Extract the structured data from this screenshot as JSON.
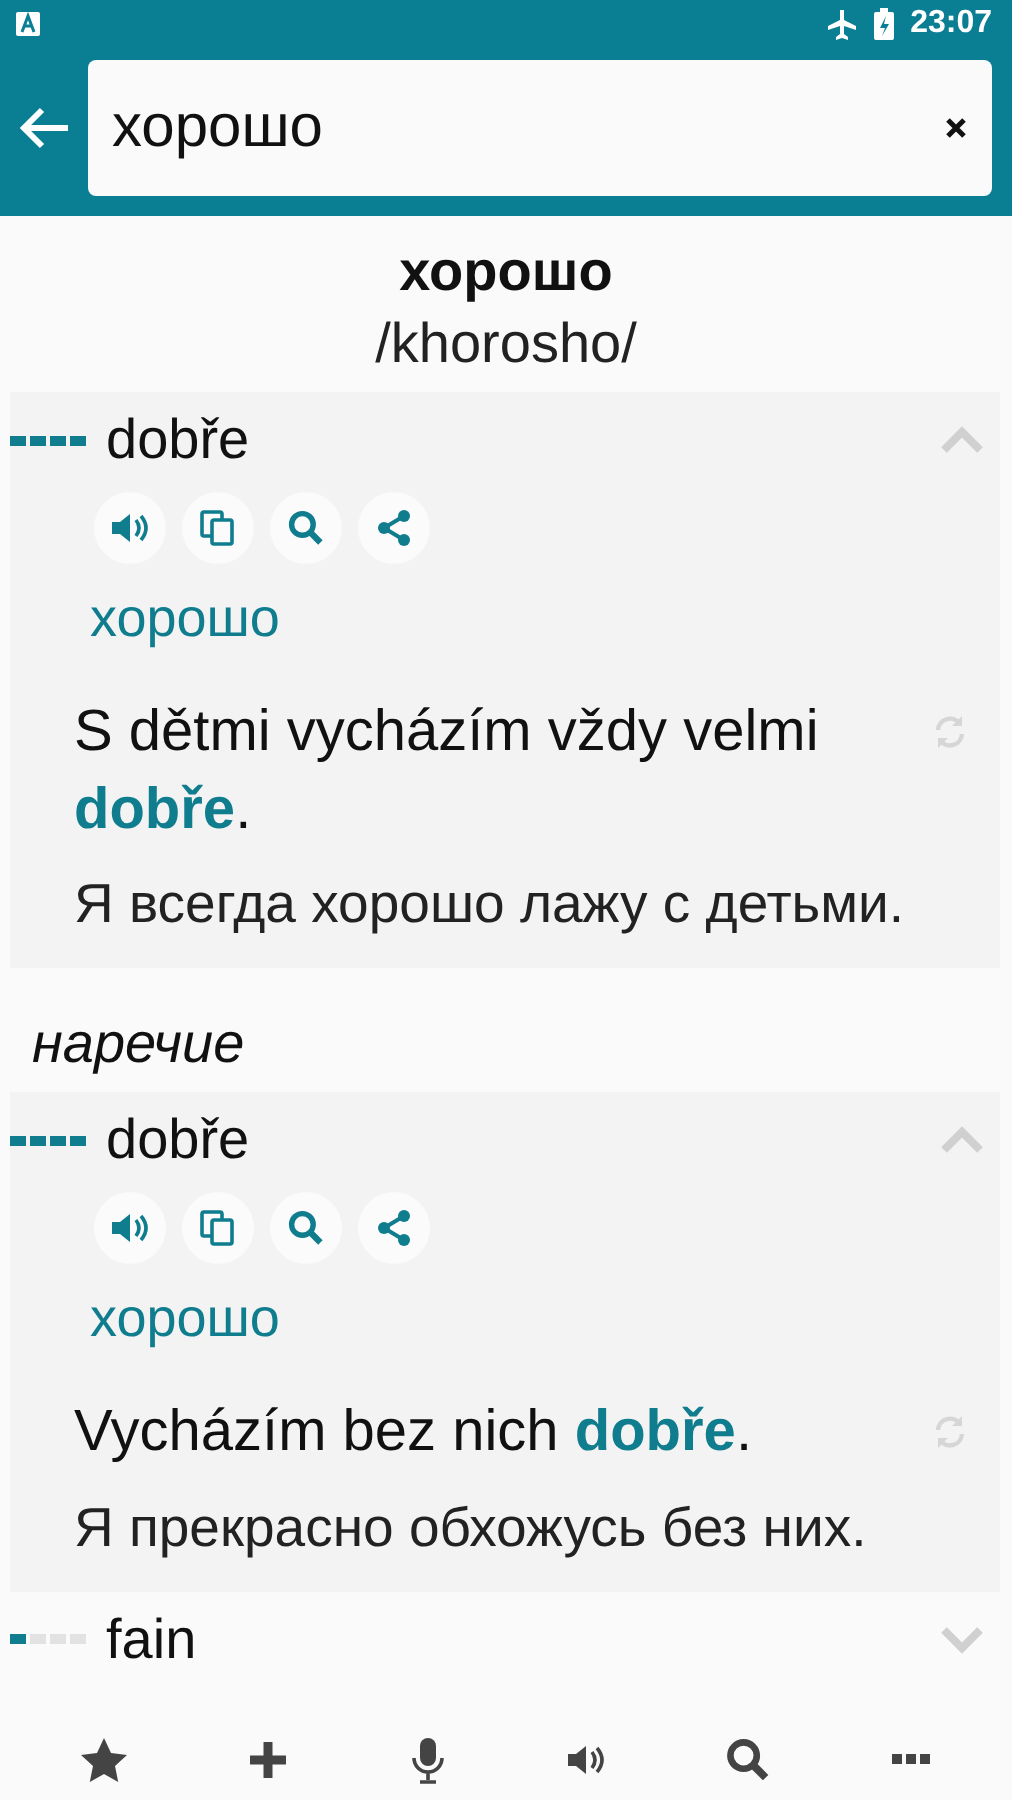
{
  "status_bar": {
    "time": "23:07"
  },
  "search": {
    "value": "хорошо"
  },
  "headword": {
    "word": "хорошо",
    "transcription": "/khorosho/"
  },
  "sections": [
    {
      "entries": [
        {
          "word": "dobře",
          "level": 1,
          "expanded": true,
          "translation": "хорошо",
          "examples": [
            {
              "source": "S dětmi vycházím vždy velmi **dobře**.",
              "target": "Я всегда хорошо лажу с детьми."
            }
          ]
        }
      ]
    },
    {
      "part_of_speech": "наречие",
      "entries": [
        {
          "word": "dobře",
          "level": 1,
          "expanded": true,
          "translation": "хорошо",
          "examples": [
            {
              "source": "Vycházím bez nich **dobře**.",
              "target": "Я прекрасно обхожусь без них."
            }
          ]
        },
        {
          "word": "fain",
          "level": 0.25,
          "expanded": false
        }
      ]
    }
  ]
}
